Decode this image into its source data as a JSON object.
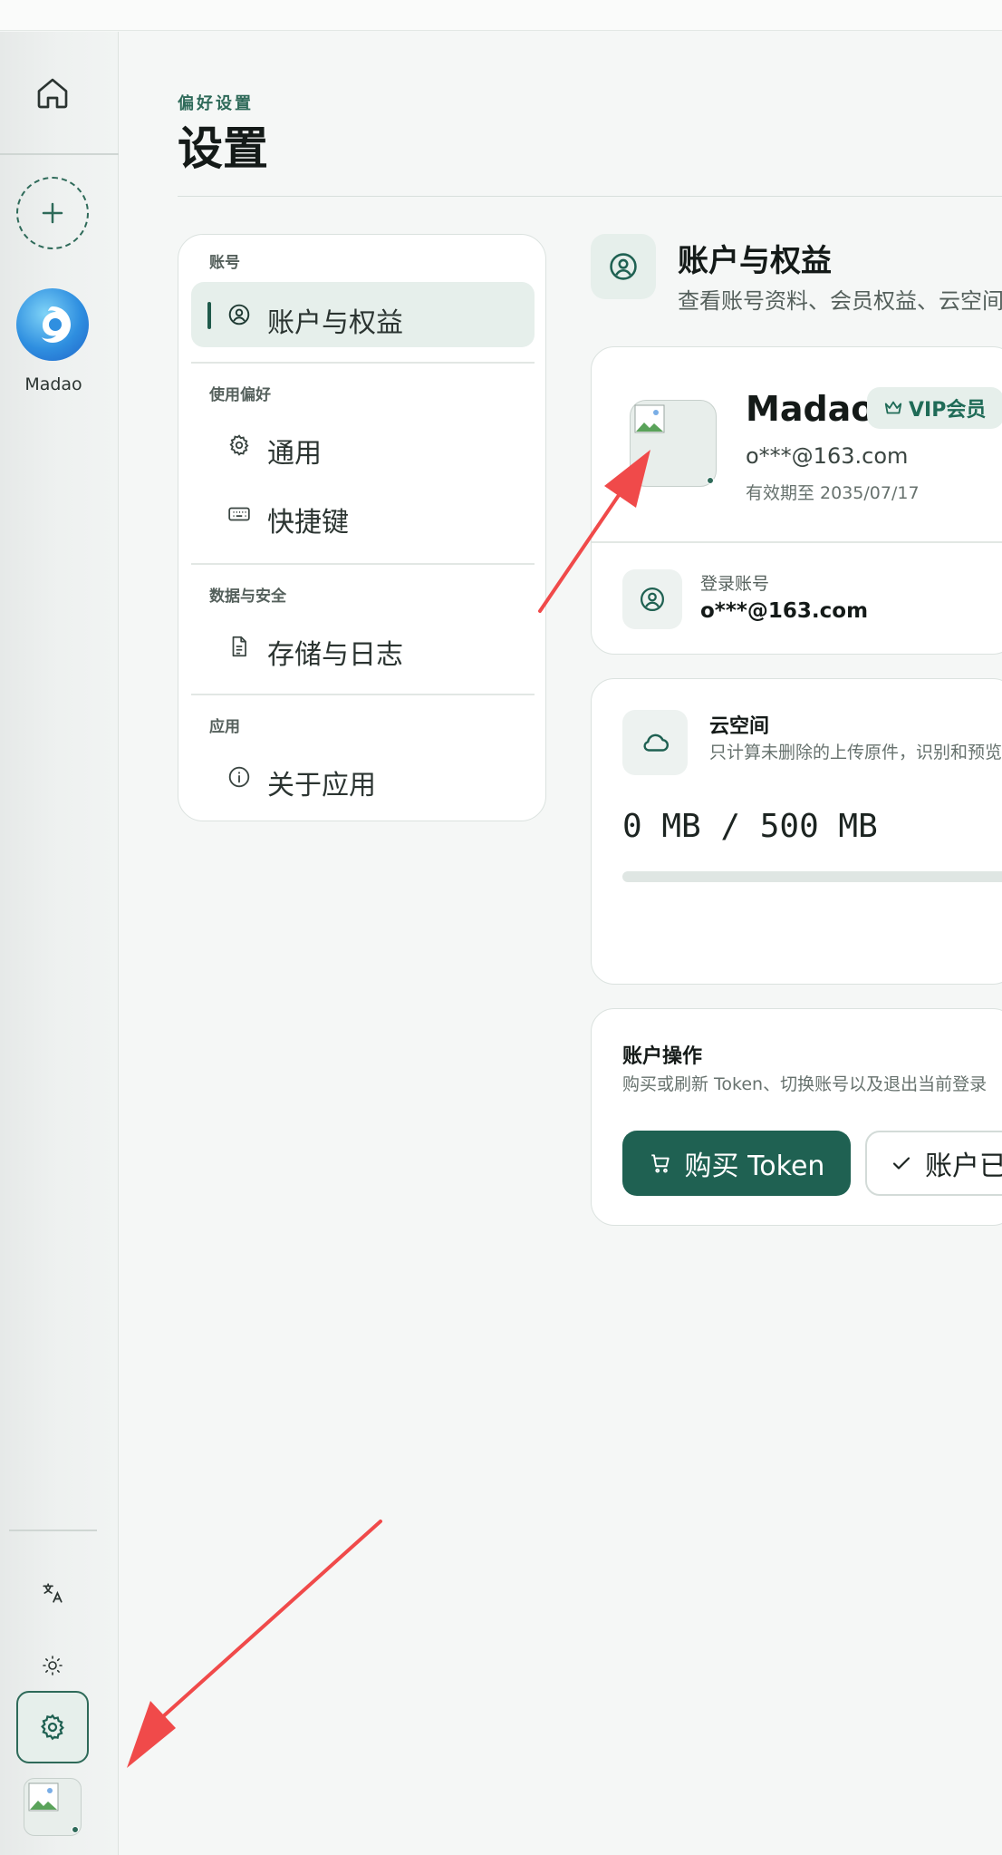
{
  "rail": {
    "app_label": "Madao"
  },
  "header": {
    "eyebrow": "偏好设置",
    "title": "设置"
  },
  "nav": {
    "sections": [
      {
        "title": "账号",
        "items": [
          {
            "label": "账户与权益",
            "icon": "user-circle-icon",
            "active": true
          }
        ]
      },
      {
        "title": "使用偏好",
        "items": [
          {
            "label": "通用",
            "icon": "gear-icon"
          },
          {
            "label": "快捷键",
            "icon": "keyboard-icon"
          }
        ]
      },
      {
        "title": "数据与安全",
        "items": [
          {
            "label": "存储与日志",
            "icon": "document-icon"
          }
        ]
      },
      {
        "title": "应用",
        "items": [
          {
            "label": "关于应用",
            "icon": "info-icon"
          }
        ]
      }
    ]
  },
  "content": {
    "title": "账户与权益",
    "description": "查看账号资料、会员权益、云空间",
    "profile": {
      "name": "Madao",
      "badge": "VIP会员",
      "email": "o***@163.com",
      "expiry": "有效期至 2035/07/17",
      "login_label": "登录账号",
      "login_value": "o***@163.com"
    },
    "cloud": {
      "title": "云空间",
      "description": "只计算未删除的上传原件，识别和预览",
      "usage": "0 MB / 500 MB",
      "used_fraction": 0
    },
    "ops": {
      "title": "账户操作",
      "description": "购买或刷新 Token、切换账号以及退出当前登录",
      "buy_label": "购买 Token",
      "account_label": "账户已"
    }
  },
  "colors": {
    "accent": "#1f6152",
    "accent_soft": "#e6efeb",
    "arrow": "#f04a4a"
  }
}
